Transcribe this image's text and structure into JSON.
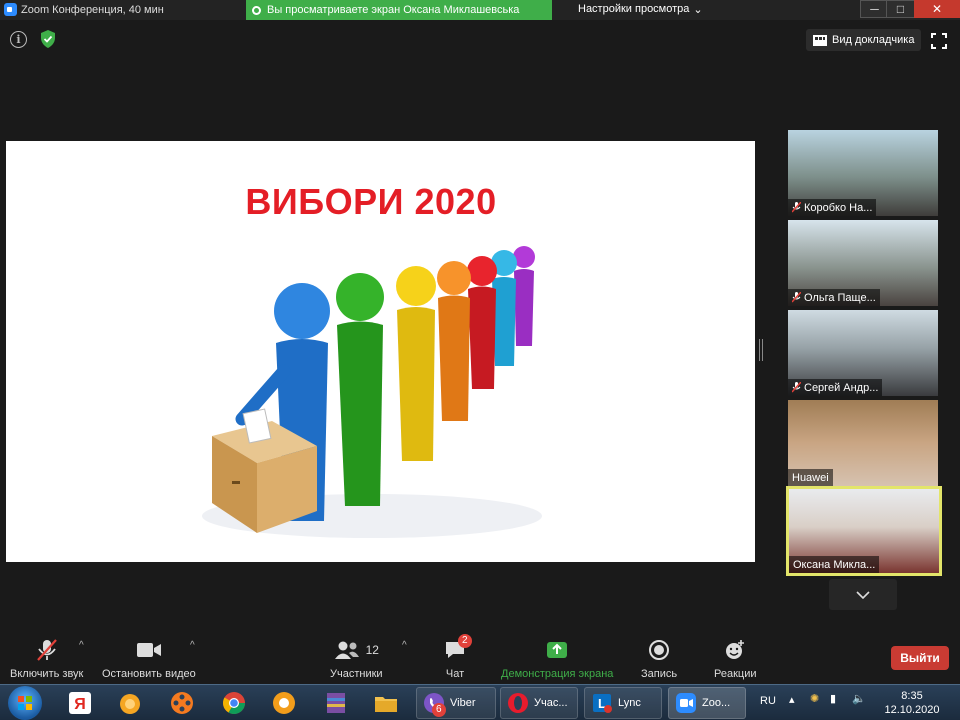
{
  "titlebar": {
    "app_title": "Zoom Конференция, 40 мин",
    "share_banner": "Вы просматриваете экран Оксана Миклашевська",
    "view_options": "Настройки просмотра",
    "minimize": "─",
    "maximize": "□",
    "close": "✕"
  },
  "top_controls": {
    "speaker_view": "Вид докладчика"
  },
  "slide": {
    "title": "ВИБОРИ 2020"
  },
  "participants": [
    {
      "name": "Коробко На...",
      "muted": true
    },
    {
      "name": "Ольга Паще...",
      "muted": true
    },
    {
      "name": "Сергей Андр...",
      "muted": true
    },
    {
      "name": "Huawei",
      "muted": false
    },
    {
      "name": "Оксана Микла...",
      "muted": false
    }
  ],
  "toolbar": {
    "unmute": "Включить звук",
    "stop_video": "Остановить видео",
    "participants": "Участники",
    "participants_count": "12",
    "chat": "Чат",
    "chat_badge": "2",
    "share_screen": "Демонстрация экрана",
    "record": "Запись",
    "reactions": "Реакции",
    "leave": "Выйти"
  },
  "taskbar": {
    "tasks": [
      {
        "label": "Viber",
        "badge": "6"
      },
      {
        "label": "Учас..."
      },
      {
        "label": "Lync"
      },
      {
        "label": "Zoo..."
      }
    ],
    "language": "RU",
    "time": "8:35",
    "date": "12.10.2020"
  },
  "colors": {
    "accent_green": "#3fae49",
    "leave_red": "#c93b33",
    "slide_title_red": "#e41e26",
    "active_speaker_border": "#e3e56a"
  }
}
